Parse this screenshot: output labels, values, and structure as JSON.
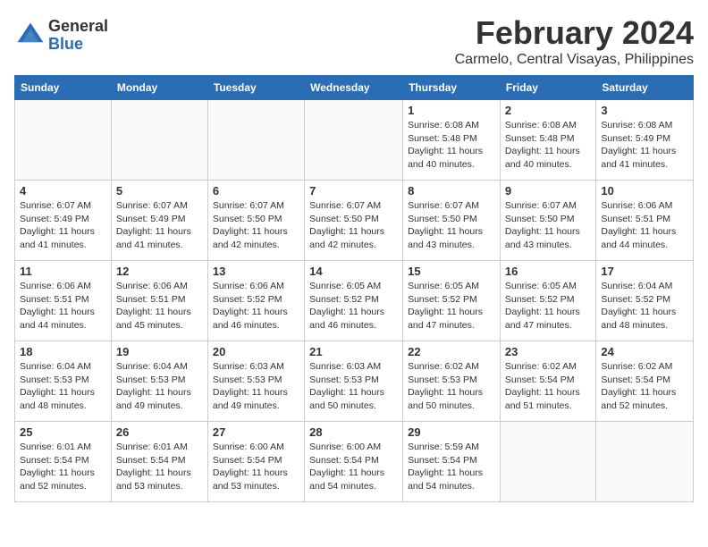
{
  "logo": {
    "general": "General",
    "blue": "Blue"
  },
  "title": {
    "month_year": "February 2024",
    "location": "Carmelo, Central Visayas, Philippines"
  },
  "weekdays": [
    "Sunday",
    "Monday",
    "Tuesday",
    "Wednesday",
    "Thursday",
    "Friday",
    "Saturday"
  ],
  "weeks": [
    [
      {
        "day": "",
        "info": ""
      },
      {
        "day": "",
        "info": ""
      },
      {
        "day": "",
        "info": ""
      },
      {
        "day": "",
        "info": ""
      },
      {
        "day": "1",
        "info": "Sunrise: 6:08 AM\nSunset: 5:48 PM\nDaylight: 11 hours\nand 40 minutes."
      },
      {
        "day": "2",
        "info": "Sunrise: 6:08 AM\nSunset: 5:48 PM\nDaylight: 11 hours\nand 40 minutes."
      },
      {
        "day": "3",
        "info": "Sunrise: 6:08 AM\nSunset: 5:49 PM\nDaylight: 11 hours\nand 41 minutes."
      }
    ],
    [
      {
        "day": "4",
        "info": "Sunrise: 6:07 AM\nSunset: 5:49 PM\nDaylight: 11 hours\nand 41 minutes."
      },
      {
        "day": "5",
        "info": "Sunrise: 6:07 AM\nSunset: 5:49 PM\nDaylight: 11 hours\nand 41 minutes."
      },
      {
        "day": "6",
        "info": "Sunrise: 6:07 AM\nSunset: 5:50 PM\nDaylight: 11 hours\nand 42 minutes."
      },
      {
        "day": "7",
        "info": "Sunrise: 6:07 AM\nSunset: 5:50 PM\nDaylight: 11 hours\nand 42 minutes."
      },
      {
        "day": "8",
        "info": "Sunrise: 6:07 AM\nSunset: 5:50 PM\nDaylight: 11 hours\nand 43 minutes."
      },
      {
        "day": "9",
        "info": "Sunrise: 6:07 AM\nSunset: 5:50 PM\nDaylight: 11 hours\nand 43 minutes."
      },
      {
        "day": "10",
        "info": "Sunrise: 6:06 AM\nSunset: 5:51 PM\nDaylight: 11 hours\nand 44 minutes."
      }
    ],
    [
      {
        "day": "11",
        "info": "Sunrise: 6:06 AM\nSunset: 5:51 PM\nDaylight: 11 hours\nand 44 minutes."
      },
      {
        "day": "12",
        "info": "Sunrise: 6:06 AM\nSunset: 5:51 PM\nDaylight: 11 hours\nand 45 minutes."
      },
      {
        "day": "13",
        "info": "Sunrise: 6:06 AM\nSunset: 5:52 PM\nDaylight: 11 hours\nand 46 minutes."
      },
      {
        "day": "14",
        "info": "Sunrise: 6:05 AM\nSunset: 5:52 PM\nDaylight: 11 hours\nand 46 minutes."
      },
      {
        "day": "15",
        "info": "Sunrise: 6:05 AM\nSunset: 5:52 PM\nDaylight: 11 hours\nand 47 minutes."
      },
      {
        "day": "16",
        "info": "Sunrise: 6:05 AM\nSunset: 5:52 PM\nDaylight: 11 hours\nand 47 minutes."
      },
      {
        "day": "17",
        "info": "Sunrise: 6:04 AM\nSunset: 5:52 PM\nDaylight: 11 hours\nand 48 minutes."
      }
    ],
    [
      {
        "day": "18",
        "info": "Sunrise: 6:04 AM\nSunset: 5:53 PM\nDaylight: 11 hours\nand 48 minutes."
      },
      {
        "day": "19",
        "info": "Sunrise: 6:04 AM\nSunset: 5:53 PM\nDaylight: 11 hours\nand 49 minutes."
      },
      {
        "day": "20",
        "info": "Sunrise: 6:03 AM\nSunset: 5:53 PM\nDaylight: 11 hours\nand 49 minutes."
      },
      {
        "day": "21",
        "info": "Sunrise: 6:03 AM\nSunset: 5:53 PM\nDaylight: 11 hours\nand 50 minutes."
      },
      {
        "day": "22",
        "info": "Sunrise: 6:02 AM\nSunset: 5:53 PM\nDaylight: 11 hours\nand 50 minutes."
      },
      {
        "day": "23",
        "info": "Sunrise: 6:02 AM\nSunset: 5:54 PM\nDaylight: 11 hours\nand 51 minutes."
      },
      {
        "day": "24",
        "info": "Sunrise: 6:02 AM\nSunset: 5:54 PM\nDaylight: 11 hours\nand 52 minutes."
      }
    ],
    [
      {
        "day": "25",
        "info": "Sunrise: 6:01 AM\nSunset: 5:54 PM\nDaylight: 11 hours\nand 52 minutes."
      },
      {
        "day": "26",
        "info": "Sunrise: 6:01 AM\nSunset: 5:54 PM\nDaylight: 11 hours\nand 53 minutes."
      },
      {
        "day": "27",
        "info": "Sunrise: 6:00 AM\nSunset: 5:54 PM\nDaylight: 11 hours\nand 53 minutes."
      },
      {
        "day": "28",
        "info": "Sunrise: 6:00 AM\nSunset: 5:54 PM\nDaylight: 11 hours\nand 54 minutes."
      },
      {
        "day": "29",
        "info": "Sunrise: 5:59 AM\nSunset: 5:54 PM\nDaylight: 11 hours\nand 54 minutes."
      },
      {
        "day": "",
        "info": ""
      },
      {
        "day": "",
        "info": ""
      }
    ]
  ]
}
